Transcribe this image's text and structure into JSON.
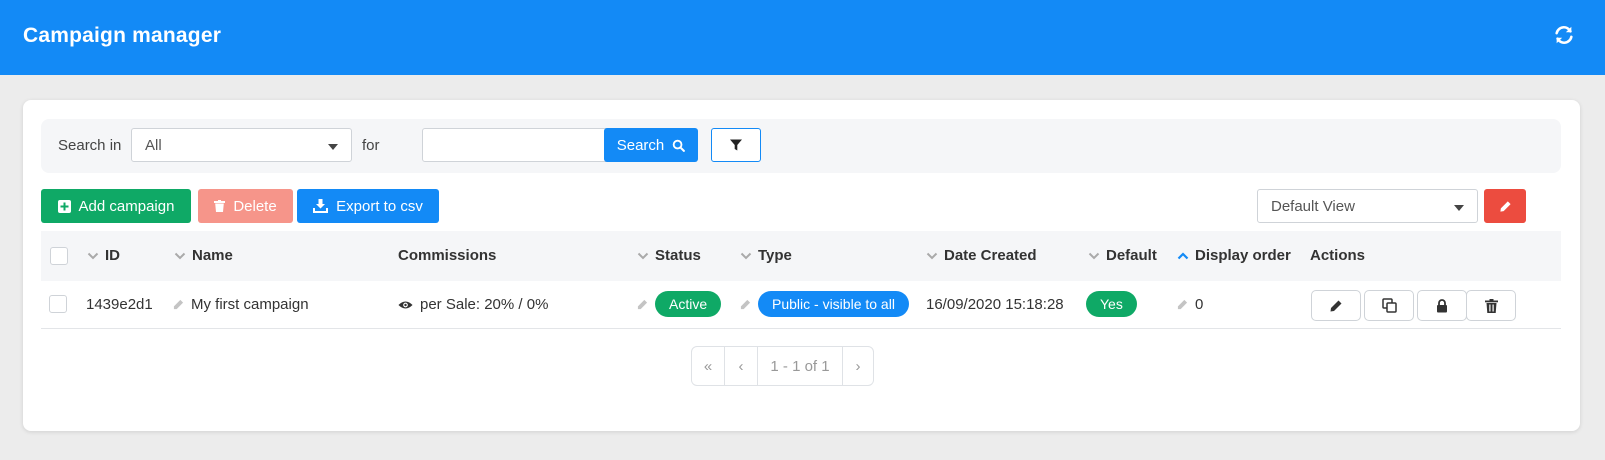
{
  "header": {
    "title": "Campaign manager",
    "refresh_icon": "refresh-icon"
  },
  "search": {
    "search_in_label": "Search in",
    "search_in_value": "All",
    "for_label": "for",
    "query_value": "",
    "query_placeholder": "",
    "search_button": "Search",
    "filter_icon": "filter-icon"
  },
  "toolbar": {
    "add_label": "Add campaign",
    "delete_label": "Delete",
    "export_label": "Export to csv",
    "view_value": "Default View"
  },
  "table": {
    "columns": {
      "id": "ID",
      "name": "Name",
      "commissions": "Commissions",
      "status": "Status",
      "type": "Type",
      "date_created": "Date Created",
      "default": "Default",
      "display_order": "Display order",
      "actions": "Actions"
    },
    "rows": [
      {
        "id": "1439e2d1",
        "name": "My first campaign",
        "commissions": "per Sale: 20% / 0%",
        "status": "Active",
        "type": "Public - visible to all",
        "date_created": "16/09/2020 15:18:28",
        "default": "Yes",
        "display_order": "0"
      }
    ]
  },
  "pagination": {
    "first": "«",
    "prev": "‹",
    "info": "1 - 1 of 1",
    "next": "›"
  },
  "colors": {
    "primary": "#138af6",
    "success": "#0fa966",
    "danger": "#ec4c3f",
    "danger_light": "#f6958a"
  }
}
